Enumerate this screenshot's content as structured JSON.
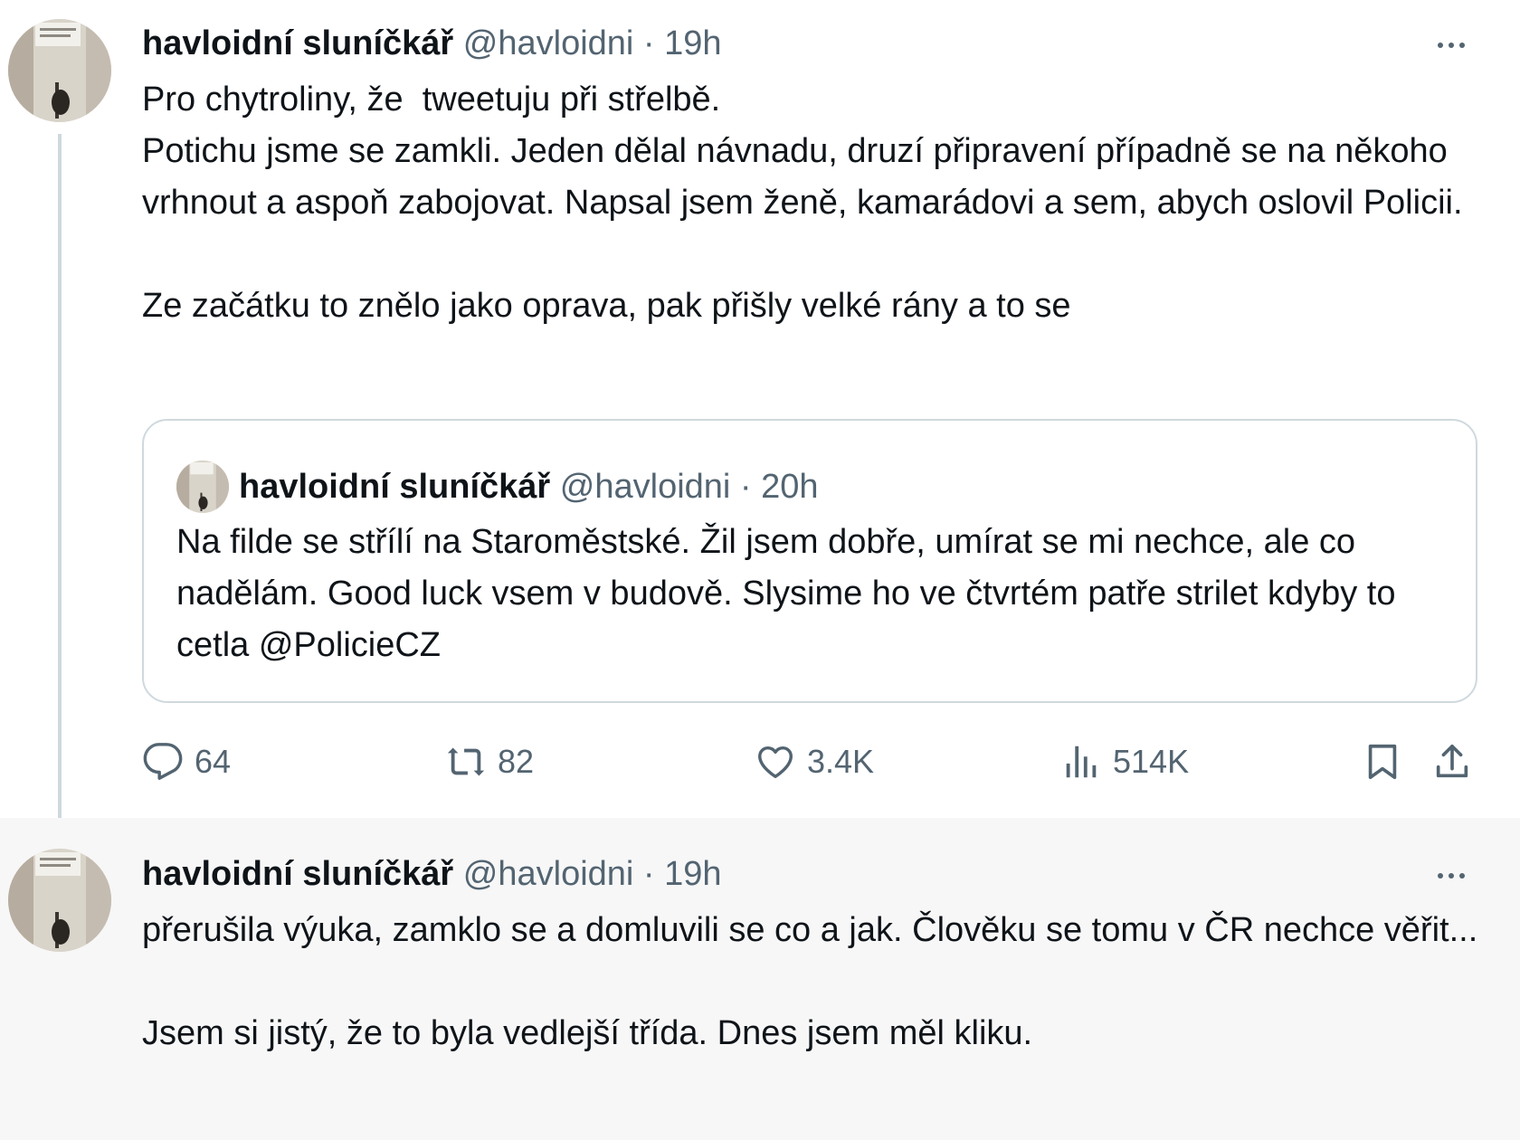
{
  "tweets": [
    {
      "author": "havloidní sluníčkář",
      "handle": "@havloidni",
      "time": "· 19h",
      "text": "Pro chytroliny, že  tweetuju při střelbě.\nPotichu jsme se zamkli. Jeden dělal návnadu, druzí připravení případně se na někoho vrhnout a aspoň zabojovat. Napsal jsem ženě, kamarádovi a sem, abych oslovil Policii.\n\nZe začátku to znělo jako oprava, pak přišly velké rány a to se",
      "quote": {
        "author": "havloidní sluníčkář",
        "handle": "@havloidni",
        "time": "· 20h",
        "text": "Na filde se střílí na Staroměstské. Žil jsem dobře, umírat se mi nechce, ale co nadělám. Good luck vsem v budově. Slysime ho ve čtvrtém patře strilet kdyby to cetla @PolicieCZ"
      },
      "stats": {
        "replies": "64",
        "retweets": "82",
        "likes": "3.4K",
        "views": "514K"
      }
    },
    {
      "author": "havloidní sluníčkář",
      "handle": "@havloidni",
      "time": "· 19h",
      "text": "přerušila výuka, zamklo se a domluvili se co a jak. Člověku se tomu v ČR nechce věřit...\n\nJsem si jistý, že to byla vedlejší třída. Dnes jsem měl kliku."
    }
  ],
  "icons": {
    "reply": "reply-icon",
    "retweet": "retweet-icon",
    "like": "heart-icon",
    "views": "views-icon",
    "bookmark": "bookmark-icon",
    "share": "share-icon",
    "more": "more-icon"
  },
  "colors": {
    "text": "#0f1419",
    "secondary": "#536471",
    "border": "#cfd9de",
    "reply_background": "#f7f7f7"
  }
}
